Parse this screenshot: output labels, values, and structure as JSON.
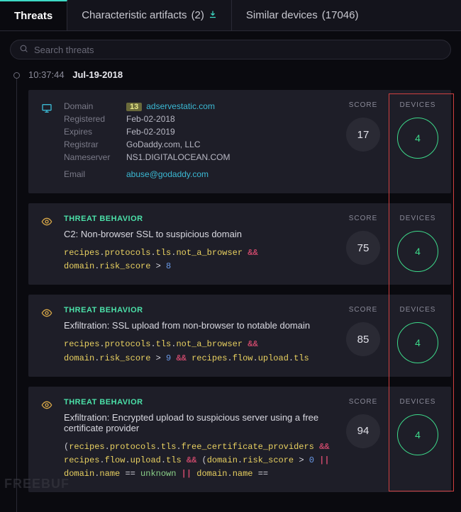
{
  "tabs": {
    "threats": "Threats",
    "artifacts_label": "Characteristic artifacts",
    "artifacts_count": "(2)",
    "similar_label": "Similar devices",
    "similar_count": "(17046)"
  },
  "search": {
    "placeholder": "Search threats"
  },
  "timestamp": {
    "time": "10:37:44",
    "date": "Jul-19-2018"
  },
  "labels": {
    "score": "SCORE",
    "devices": "DEVICES",
    "threat_behavior": "THREAT BEHAVIOR",
    "domain": "Domain",
    "registered": "Registered",
    "expires": "Expires",
    "registrar": "Registrar",
    "nameserver": "Nameserver",
    "email": "Email"
  },
  "domain_card": {
    "badge": "13",
    "domain": "adservestatic.com",
    "registered": "Feb-02-2018",
    "expires": "Feb-02-2019",
    "registrar": "GoDaddy.com, LLC",
    "nameserver": "NS1.DIGITALOCEAN.COM",
    "email": "abuse@godaddy.com",
    "score": "17",
    "devices": "4"
  },
  "threats": [
    {
      "title": "C2: Non-browser SSL to suspicious domain",
      "score": "75",
      "devices": "4",
      "rule_html": "<span class='key'>recipes</span>.<span class='key'>protocols</span>.<span class='key'>tls</span>.<span class='key'>not_a_browser</span> <span class='amp'>&&</span> <span class='key'>domain</span>.<span class='key'>risk_score</span> <span class='op'>&gt;</span> <span class='num'>8</span>"
    },
    {
      "title": "Exfiltration: SSL upload from non-browser to notable domain",
      "score": "85",
      "devices": "4",
      "rule_html": "<span class='key'>recipes</span>.<span class='key'>protocols</span>.<span class='key'>tls</span>.<span class='key'>not_a_browser</span> <span class='amp'>&&</span> <span class='key'>domain</span>.<span class='key'>risk_score</span> <span class='op'>&gt;</span> <span class='num'>9</span> <span class='amp'>&&</span> <span class='key'>recipes</span>.<span class='key'>flow</span>.<span class='key'>upload</span>.<span class='key'>tls</span>"
    },
    {
      "title": "Exfiltration: Encrypted upload to suspicious server using a free certificate provider",
      "score": "94",
      "devices": "4",
      "rule_html": "(<span class='key'>recipes</span>.<span class='key'>protocols</span>.<span class='key'>tls</span>.<span class='key'>free_certificate_providers</span> <span class='amp'>&&</span> <span class='key'>recipes</span>.<span class='key'>flow</span>.<span class='key'>upload</span>.<span class='key'>tls</span> <span class='amp'>&&</span> (<span class='key'>domain</span>.<span class='key'>risk_score</span> <span class='op'>&gt;</span> <span class='num'>0</span> <span class='amp'>||</span> <span class='key'>domain</span>.<span class='key'>name</span> <span class='op'>==</span> <span class='val'>unknown</span> <span class='amp'>||</span> <span class='key'>domain</span>.<span class='key'>name</span> <span class='op'>==</span>"
    }
  ],
  "watermark": "FREEBUF"
}
